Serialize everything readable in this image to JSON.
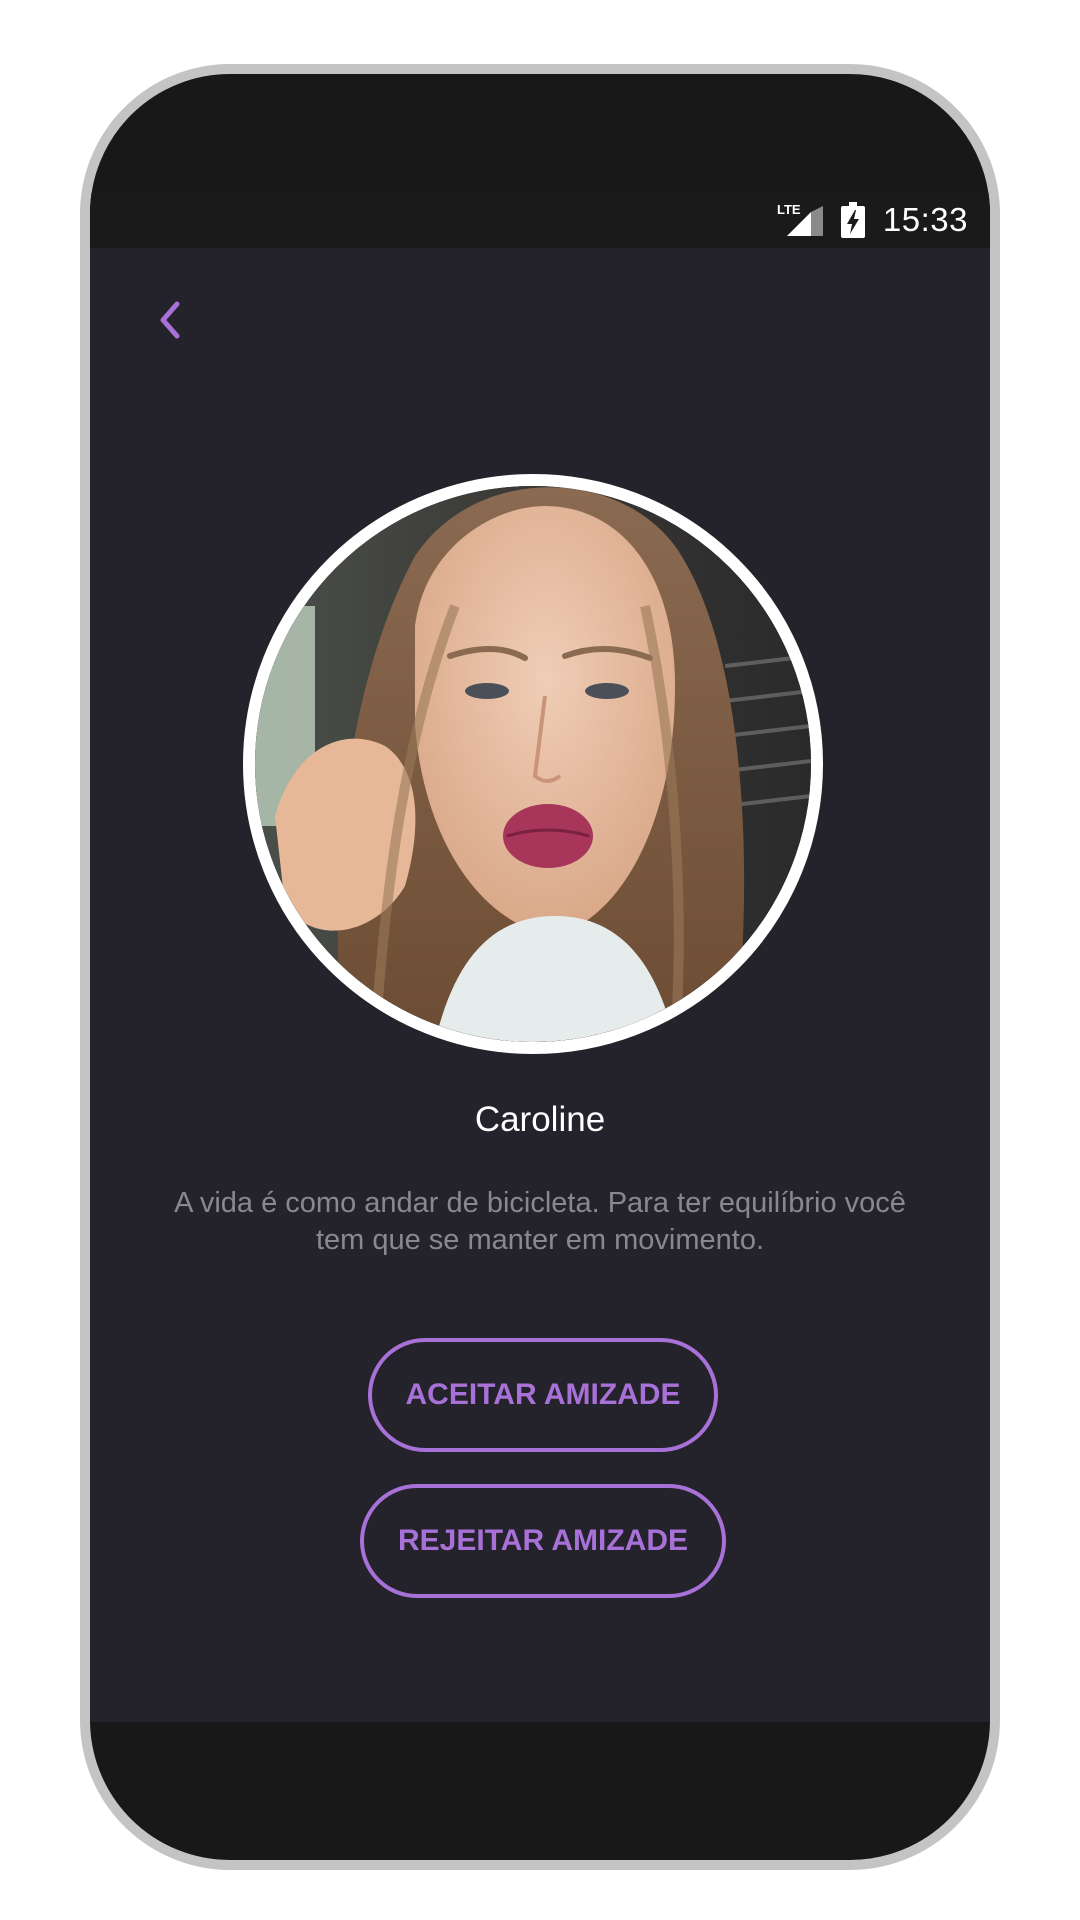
{
  "status_bar": {
    "network_label": "LTE",
    "time": "15:33"
  },
  "navigation": {
    "back_icon": "chevron-left-icon"
  },
  "profile": {
    "name": "Caroline",
    "bio": "A vida é como andar de bicicleta. Para ter equilíbrio você tem que se manter em movimento."
  },
  "actions": {
    "accept_label": "ACEITAR AMIZADE",
    "reject_label": "REJEITAR AMIZADE"
  },
  "colors": {
    "accent": "#a871d8",
    "screen_background": "#24222a",
    "device_frame": "#c4c4c4",
    "bio_text": "#8a878f"
  }
}
